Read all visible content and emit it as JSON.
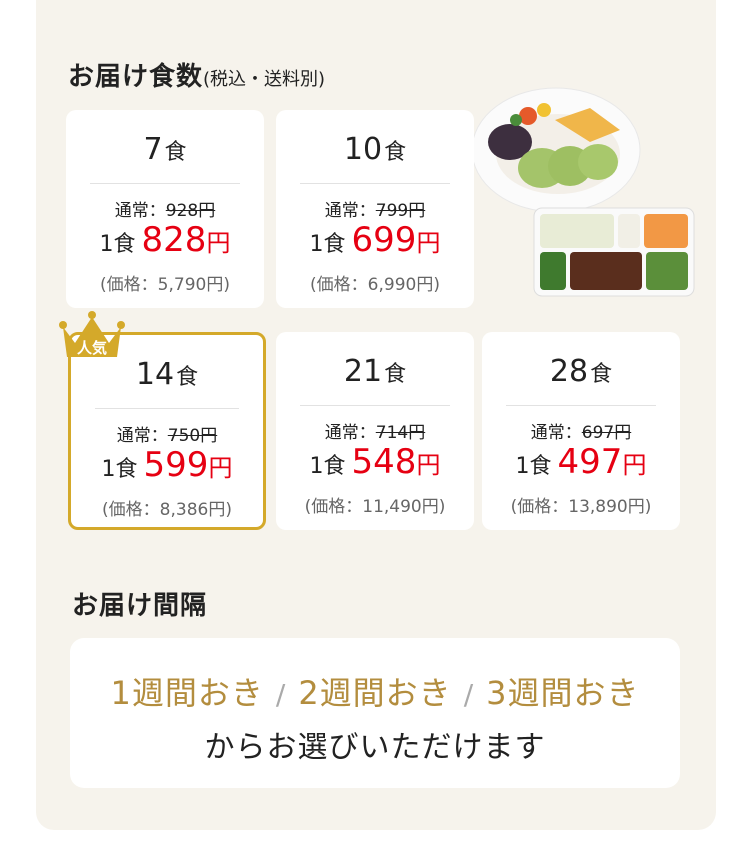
{
  "delivery_count": {
    "title": "お届け食数",
    "note": "(税込・送料別)",
    "plans": [
      {
        "count": "7",
        "unit": "食",
        "regular_label": "通常：",
        "regular_price": "928円",
        "per_label": "1食",
        "price": "828",
        "yen": "円",
        "total": "(価格：5,790円)"
      },
      {
        "count": "10",
        "unit": "食",
        "regular_label": "通常：",
        "regular_price": "799円",
        "per_label": "1食",
        "price": "699",
        "yen": "円",
        "total": "(価格：6,990円)"
      },
      {
        "count": "14",
        "unit": "食",
        "regular_label": "通常：",
        "regular_price": "750円",
        "per_label": "1食",
        "price": "599",
        "yen": "円",
        "total": "(価格：8,386円)",
        "badge": "人気"
      },
      {
        "count": "21",
        "unit": "食",
        "regular_label": "通常：",
        "regular_price": "714円",
        "per_label": "1食",
        "price": "548",
        "yen": "円",
        "total": "(価格：11,490円)"
      },
      {
        "count": "28",
        "unit": "食",
        "regular_label": "通常：",
        "regular_price": "697円",
        "per_label": "1食",
        "price": "497",
        "yen": "円",
        "total": "(価格：13,890円)"
      }
    ]
  },
  "interval": {
    "title": "お届け間隔",
    "options": [
      "1週間おき",
      "2週間おき",
      "3週間おき"
    ],
    "separator": "/",
    "description": "からお選びいただけます"
  },
  "colors": {
    "accent_red": "#e60012",
    "gold": "#b38d3e",
    "crown": "#d4a92a",
    "panel_bg": "#f6f3ec"
  }
}
